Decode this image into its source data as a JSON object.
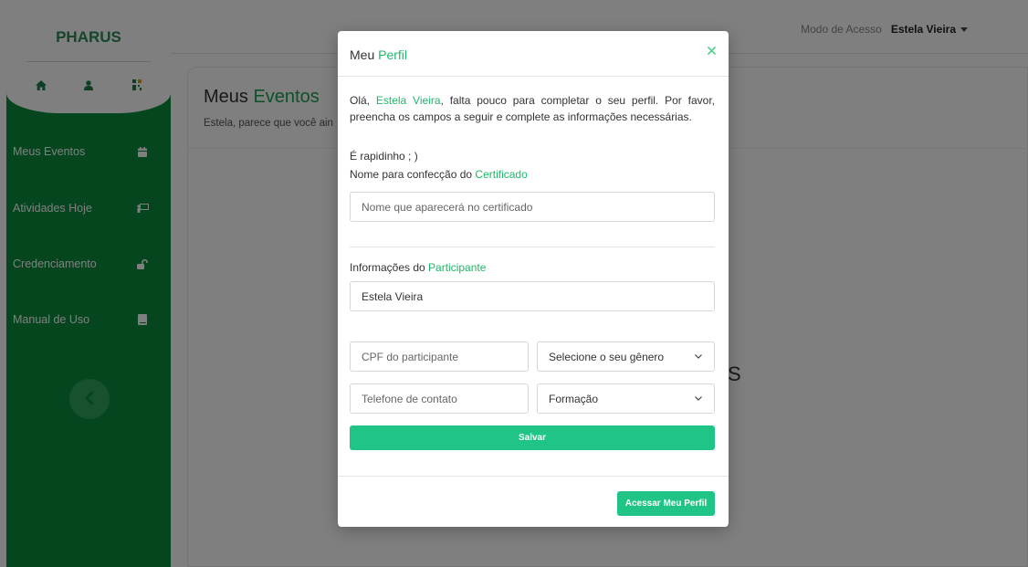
{
  "app": {
    "brand": "PHARUS"
  },
  "colors": {
    "sidebar_green": "#0c8c3f",
    "accent_green": "#1fb86a",
    "button_green": "#1fc486"
  },
  "sidebar": {
    "header_icons": [
      "home-icon",
      "user-icon",
      "qr-icon"
    ],
    "items": [
      {
        "label": "Meus Eventos",
        "icon": "calendar-icon"
      },
      {
        "label": "Atividades Hoje",
        "icon": "chalkboard-icon"
      },
      {
        "label": "Credenciamento",
        "icon": "unlock-icon"
      },
      {
        "label": "Manual de Uso",
        "icon": "book-icon"
      }
    ],
    "collapse_icon": "chevron-left-icon"
  },
  "topbar": {
    "access_label": "Modo de Acesso",
    "user_name": "Estela Vieira"
  },
  "page": {
    "title_prefix": "Meus ",
    "title_accent": "Eventos",
    "subtitle": "Estela, parece que você ain",
    "partial_glyph": "S"
  },
  "modal": {
    "title_prefix": "Meu ",
    "title_accent": "Perfil",
    "close_icon": "close-icon",
    "intro_greeting": "Olá, ",
    "intro_name": "Estela Vieira",
    "intro_rest": ", falta pouco para completar o seu perfil. Por favor, preencha os campos a seguir e complete as informações necessárias.",
    "quick_text": "É rapidinho ; )",
    "certificate_label_prefix": "Nome para confecção do ",
    "certificate_label_accent": "Certificado",
    "certificate_placeholder": "Nome que aparecerá no certificado",
    "participant_label_prefix": "Informações do ",
    "participant_label_accent": "Participante",
    "participant_name_value": "Estela Vieira",
    "cpf_placeholder": "CPF do participante",
    "gender_select": "Selecione o seu gênero",
    "phone_placeholder": "Telefone de contato",
    "education_select": "Formação",
    "save_label": "Salvar",
    "profile_button_label": "Acessar Meu Perfil"
  }
}
